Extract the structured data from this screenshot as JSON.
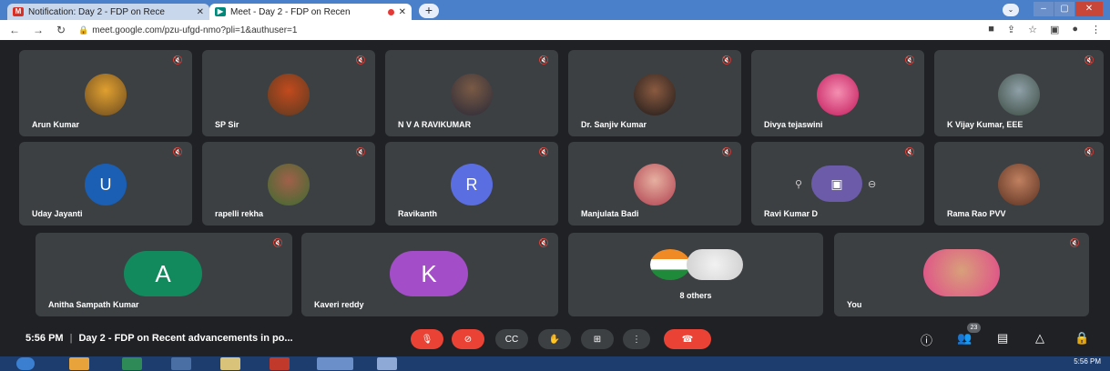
{
  "browser": {
    "tabs": [
      {
        "title": "Notification: Day 2 - FDP on Rece",
        "favicon": "gmail-icon",
        "active": false
      },
      {
        "title": "Meet - Day 2 - FDP on Recen",
        "favicon": "meet-icon",
        "active": true
      }
    ],
    "url": "meet.google.com/pzu-ufgd-nmo?pli=1&authuser=1"
  },
  "participants_row1": [
    {
      "name": "Arun Kumar"
    },
    {
      "name": "SP Sir"
    },
    {
      "name": "N V A RAVIKUMAR"
    },
    {
      "name": "Dr. Sanjiv Kumar"
    },
    {
      "name": "Divya tejaswini"
    },
    {
      "name": "K Vijay Kumar, EEE"
    }
  ],
  "participants_row2": [
    {
      "name": "Uday Jayanti",
      "initial": "U",
      "color": "#1a5fb4"
    },
    {
      "name": "rapelli rekha"
    },
    {
      "name": "Ravikanth",
      "initial": "R",
      "color": "#5b6ee1"
    },
    {
      "name": "Manjulata Badi"
    },
    {
      "name": "Ravi Kumar D"
    },
    {
      "name": "Rama Rao PVV"
    }
  ],
  "participants_row3": [
    {
      "name": "Anitha Sampath Kumar",
      "initial": "A",
      "color": "#138a5e"
    },
    {
      "name": "Kaveri reddy",
      "initial": "K",
      "color": "#a34dc8"
    },
    {
      "name": "8 others"
    },
    {
      "name": "You"
    }
  ],
  "bottom": {
    "time": "5:56 PM",
    "meeting_title": "Day 2 - FDP on Recent advancements in po...",
    "participant_count": "23"
  },
  "taskbar": {
    "clock": "5:56 PM"
  }
}
